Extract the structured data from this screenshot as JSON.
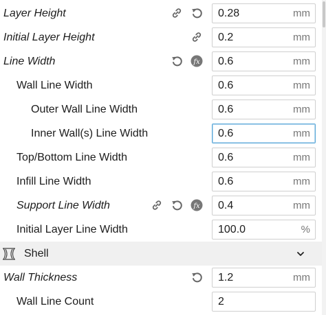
{
  "settings": [
    {
      "label": "Layer Height",
      "value": "0.28",
      "unit": "mm"
    },
    {
      "label": "Initial Layer Height",
      "value": "0.2",
      "unit": "mm"
    },
    {
      "label": "Line Width",
      "value": "0.6",
      "unit": "mm"
    },
    {
      "label": "Wall Line Width",
      "value": "0.6",
      "unit": "mm"
    },
    {
      "label": "Outer Wall Line Width",
      "value": "0.6",
      "unit": "mm"
    },
    {
      "label": "Inner Wall(s) Line Width",
      "value": "0.6",
      "unit": "mm"
    },
    {
      "label": "Top/Bottom Line Width",
      "value": "0.6",
      "unit": "mm"
    },
    {
      "label": "Infill Line Width",
      "value": "0.6",
      "unit": "mm"
    },
    {
      "label": "Support Line Width",
      "value": "0.4",
      "unit": "mm"
    },
    {
      "label": "Initial Layer Line Width",
      "value": "100.0",
      "unit": "%"
    },
    {
      "label": "Wall Thickness",
      "value": "1.2",
      "unit": "mm"
    },
    {
      "label": "Wall Line Count",
      "value": "2",
      "unit": ""
    }
  ],
  "section": {
    "title": "Shell",
    "icon": "shell-icon",
    "expand_icon": "chevron-down-icon"
  },
  "icons": {
    "link": "link-icon",
    "reset": "reset-icon",
    "function": "function-icon"
  },
  "colors": {
    "focus_border": "#5aa8d8",
    "section_bg": "#f0f0f0",
    "icon": "#666666"
  }
}
